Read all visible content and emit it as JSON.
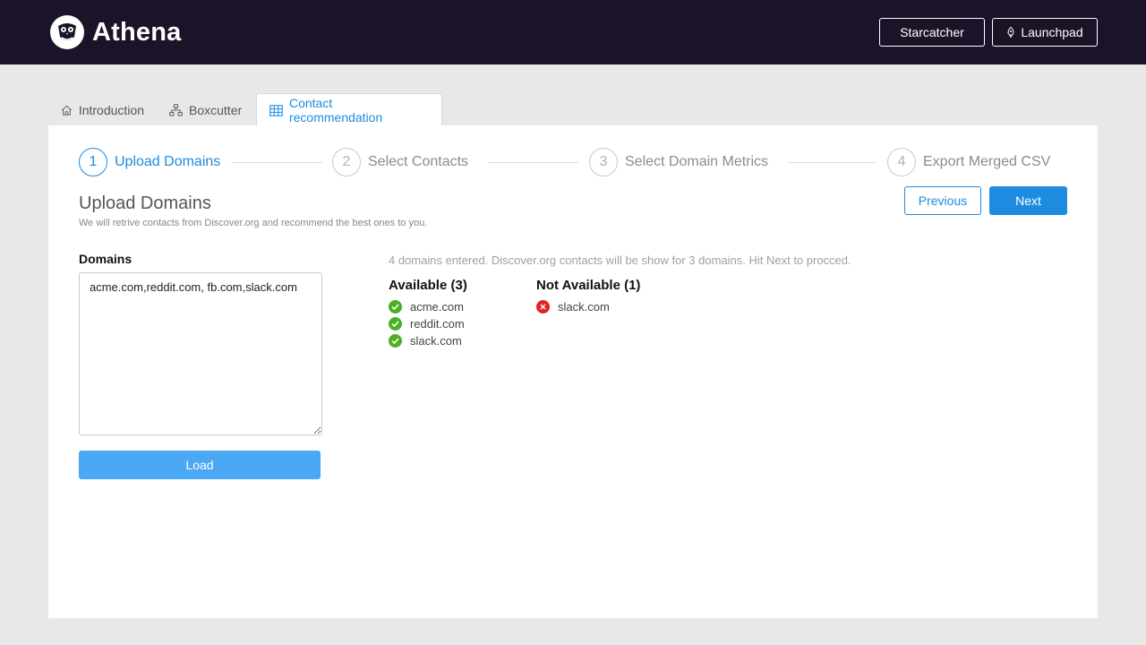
{
  "app": {
    "name": "Athena"
  },
  "header": {
    "starcatcher_label": "Starcatcher",
    "launchpad_label": "Launchpad"
  },
  "tabs": [
    {
      "label": "Introduction",
      "icon": "home-icon"
    },
    {
      "label": "Boxcutter",
      "icon": "sitemap-icon"
    },
    {
      "label": "Contact recommendation",
      "icon": "table-icon",
      "active": true
    }
  ],
  "steps": [
    {
      "num": "1",
      "label": "Upload Domains",
      "active": true
    },
    {
      "num": "2",
      "label": "Select Contacts"
    },
    {
      "num": "3",
      "label": "Select Domain Metrics"
    },
    {
      "num": "4",
      "label": "Export Merged CSV"
    }
  ],
  "section": {
    "title": "Upload Domains",
    "subtitle": "We will retrive contacts from Discover.org and recommend the best ones to you."
  },
  "nav": {
    "previous_label": "Previous",
    "next_label": "Next"
  },
  "domains": {
    "label": "Domains",
    "value": "acme.com,reddit.com, fb.com,slack.com",
    "load_label": "Load"
  },
  "results": {
    "info": "4 domains entered. Discover.org contacts will be show for 3 domains. Hit Next to procced.",
    "available_title": "Available (3)",
    "available": [
      "acme.com",
      "reddit.com",
      "slack.com"
    ],
    "unavailable_title": "Not Available (1)",
    "unavailable": [
      "slack.com"
    ]
  },
  "colors": {
    "accent": "#1d8ce0",
    "topbar": "#1b1429",
    "ok": "#4caf25",
    "error": "#e02424"
  }
}
